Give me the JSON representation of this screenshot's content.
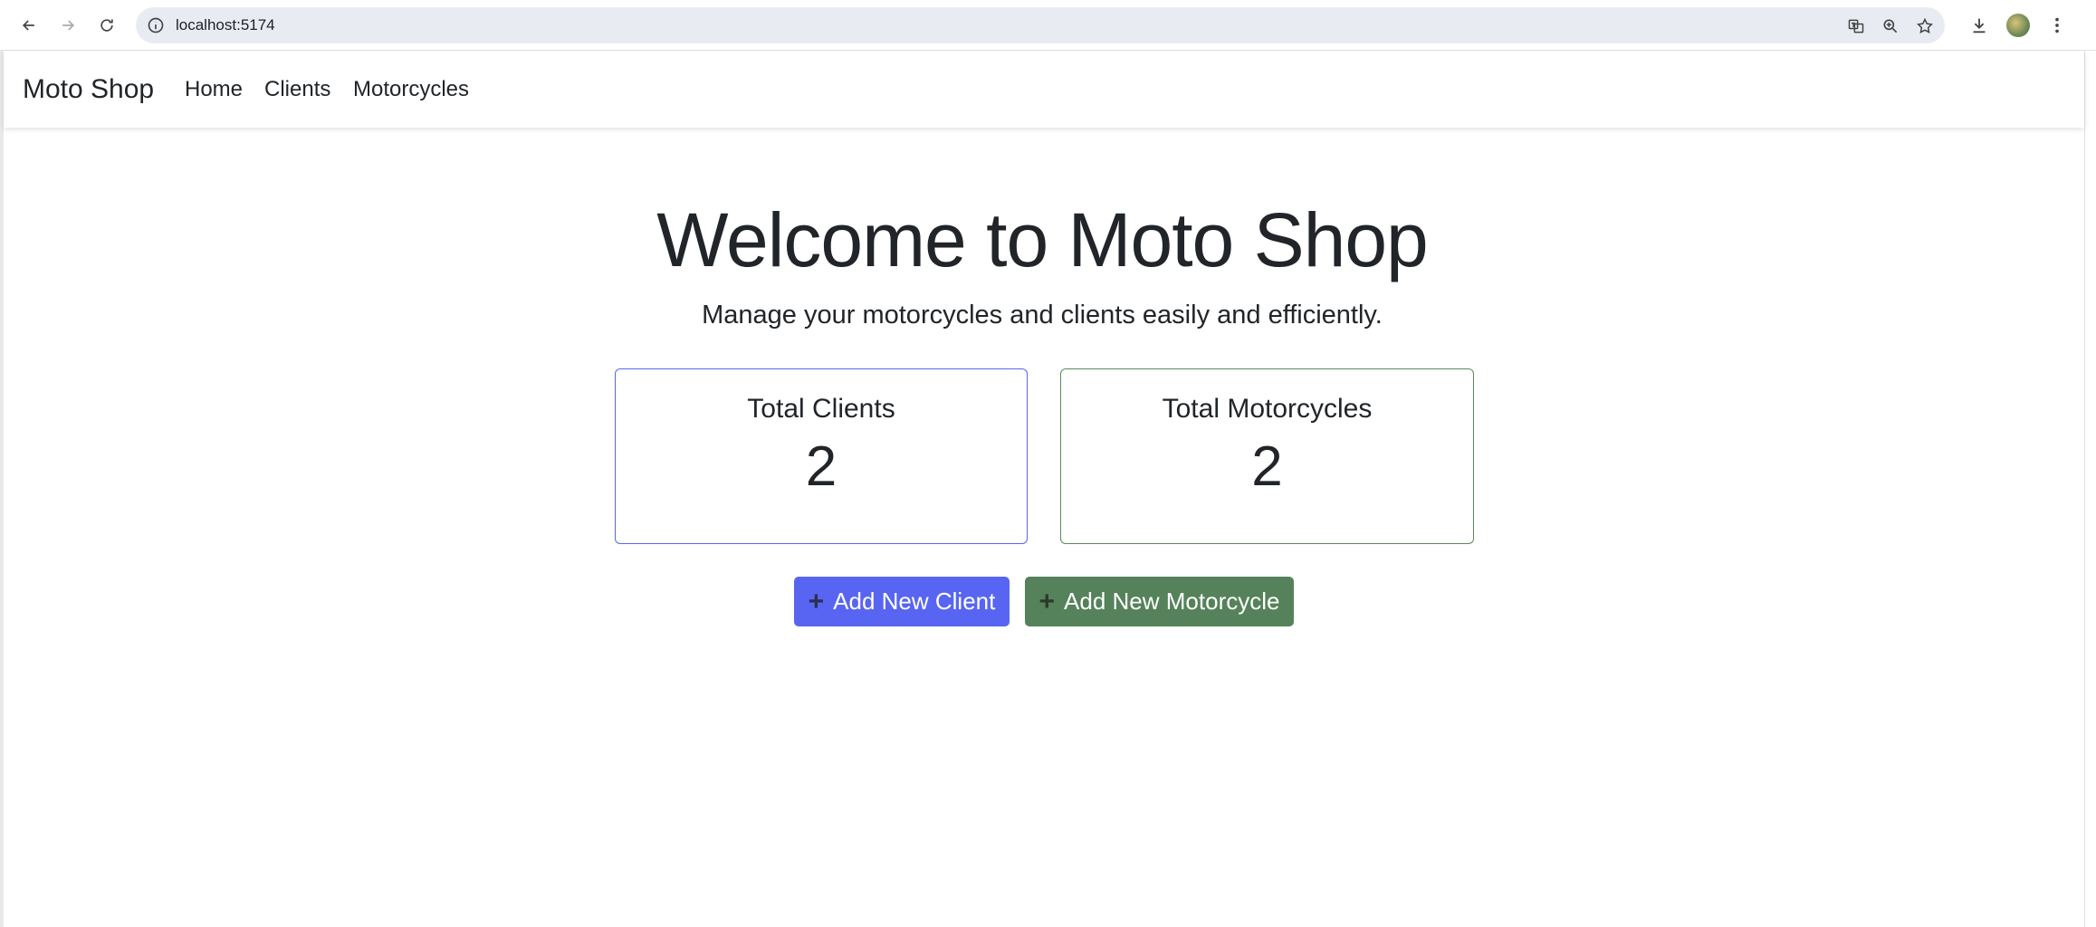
{
  "browser": {
    "url": "localhost:5174",
    "icons": [
      "back-icon",
      "forward-icon",
      "reload-icon",
      "site-info-icon",
      "translate-icon",
      "zoom-icon",
      "bookmark-star-icon",
      "download-icon",
      "profile-avatar",
      "menu-kebab-icon"
    ]
  },
  "navbar": {
    "brand": "Moto Shop",
    "links": [
      "Home",
      "Clients",
      "Motorcycles"
    ]
  },
  "hero": {
    "title": "Welcome to Moto Shop",
    "subtitle": "Manage your motorcycles and clients easily and efficiently."
  },
  "stats": {
    "clients": {
      "label": "Total Clients",
      "value": "2"
    },
    "motorcycles": {
      "label": "Total Motorcycles",
      "value": "2"
    }
  },
  "actions": {
    "add_client": "Add New Client",
    "add_motorcycle": "Add New Motorcycle",
    "plus_glyph": "+"
  },
  "colors": {
    "primary": "#5865f2",
    "success": "#55825a"
  }
}
